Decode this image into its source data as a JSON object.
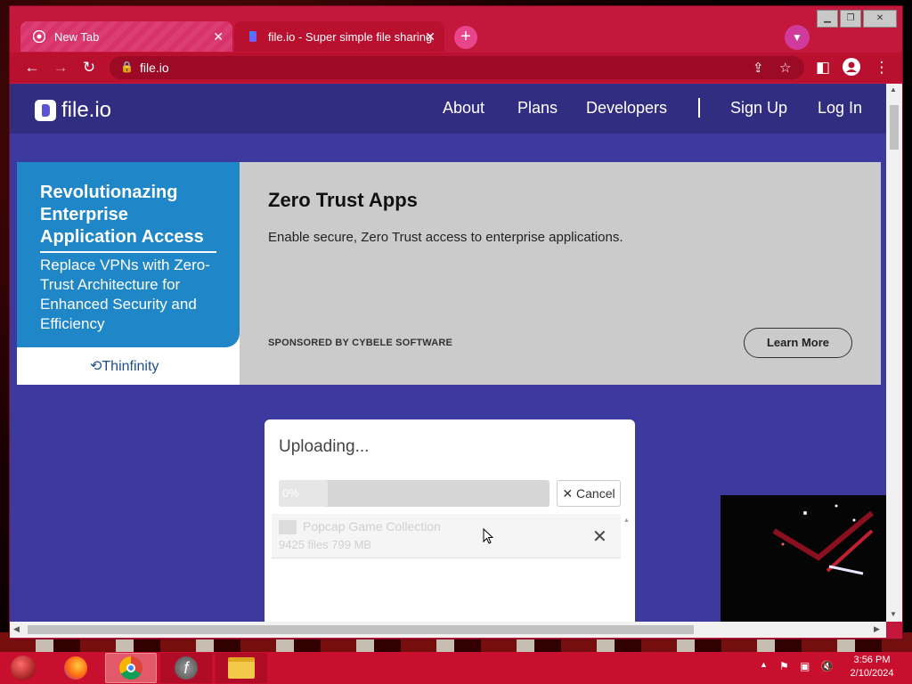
{
  "browser": {
    "tabs": [
      {
        "label": "New Tab",
        "icon": "chrome-icon",
        "active": false
      },
      {
        "label": "file.io - Super simple file sharing",
        "icon": "fileio-favicon",
        "active": true
      }
    ],
    "url": "file.io"
  },
  "site": {
    "logo_text": "file.io",
    "nav": [
      "About",
      "Plans",
      "Developers",
      "Sign Up",
      "Log In"
    ]
  },
  "ad": {
    "left_headline": "Revolutionazing Enterprise Application Access",
    "left_subtext": "Replace VPNs with Zero-Trust Architecture for Enhanced Security and Efficiency",
    "left_brand": "Thinfinity",
    "title": "Zero Trust Apps",
    "description": "Enable secure, Zero Trust access to enterprise applications.",
    "sponsor": "SPONSORED BY CYBELE SOFTWARE",
    "cta": "Learn More"
  },
  "upload": {
    "title": "Uploading...",
    "progress_text": "0%",
    "progress": 0.0,
    "cancel_label": "Cancel",
    "file_name": "Popcap Game Collection",
    "file_meta": "9425 files 799 MB"
  },
  "taskbar": {
    "time": "3:56 PM",
    "date": "2/10/2024"
  },
  "colors": {
    "browser_frame": "#c4173c",
    "site_header": "#312e81",
    "page_bg": "#3c3a9e",
    "ad_blue": "#1f86c7"
  }
}
